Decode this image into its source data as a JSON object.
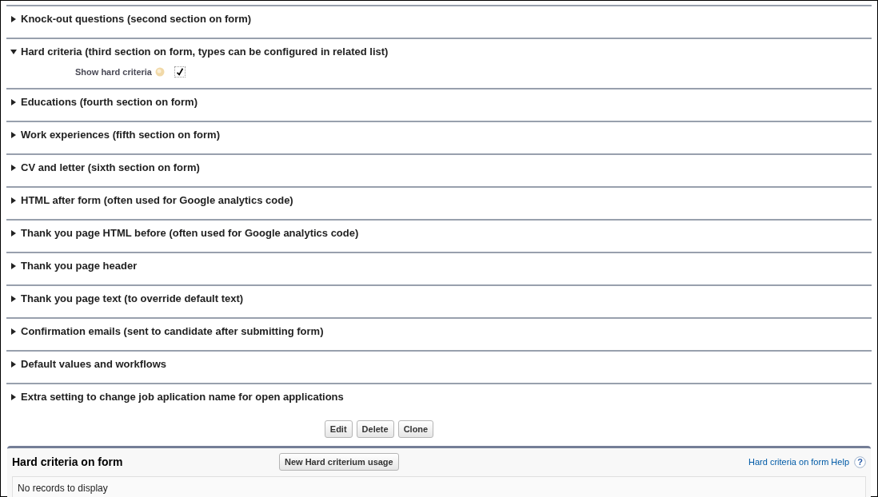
{
  "sections": [
    {
      "title": "Knock-out questions (second section on form)",
      "expanded": false
    },
    {
      "title": "Hard criteria (third section on form, types can be configured in related list)",
      "expanded": true,
      "fields": [
        {
          "label": "Show hard criteria",
          "checked": true
        }
      ]
    },
    {
      "title": "Educations (fourth section on form)",
      "expanded": false
    },
    {
      "title": "Work experiences (fifth section on form)",
      "expanded": false
    },
    {
      "title": "CV and letter (sixth section on form)",
      "expanded": false
    },
    {
      "title": "HTML after form (often used for Google analytics code)",
      "expanded": false
    },
    {
      "title": "Thank you page HTML before (often used for Google analytics code)",
      "expanded": false
    },
    {
      "title": "Thank you page header",
      "expanded": false
    },
    {
      "title": "Thank you page text (to override default text)",
      "expanded": false
    },
    {
      "title": "Confirmation emails (sent to candidate after submitting form)",
      "expanded": false
    },
    {
      "title": "Default values and workflows",
      "expanded": false
    },
    {
      "title": "Extra setting to change job aplication name for open applications",
      "expanded": false
    }
  ],
  "buttons": [
    "Edit",
    "Delete",
    "Clone"
  ],
  "related_list": {
    "title": "Hard criteria on form",
    "button": "New Hard criterium usage",
    "help_link": "Hard criteria on form Help",
    "help_icon": "?",
    "empty_text": "No records to display"
  }
}
